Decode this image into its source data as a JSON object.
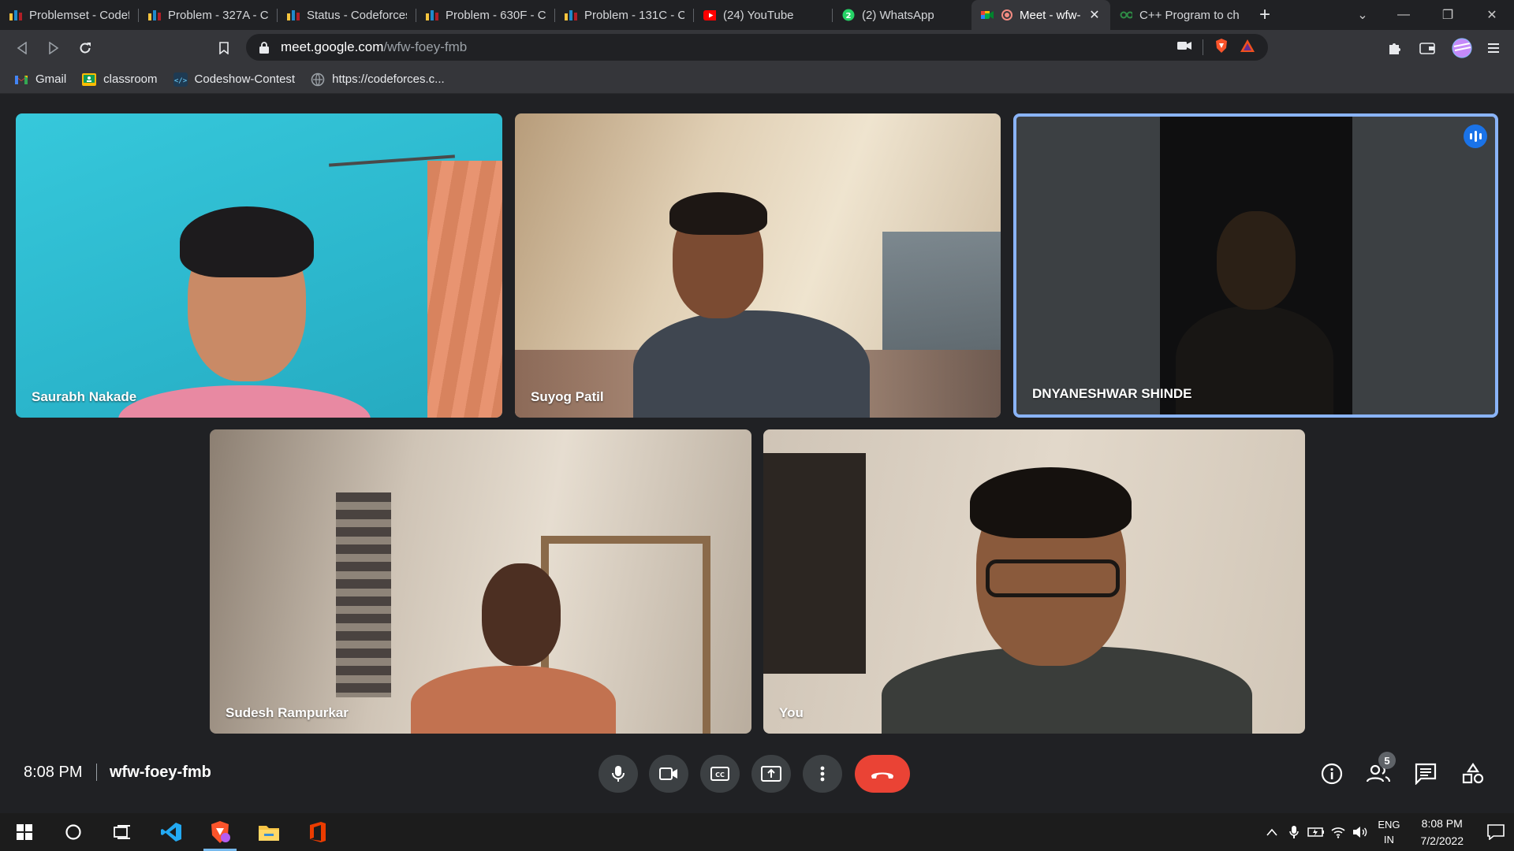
{
  "browser": {
    "tabs": [
      {
        "title": "Problemset - Codef",
        "icon": "codeforces-icon",
        "active": false
      },
      {
        "title": "Problem - 327A - Co",
        "icon": "codeforces-icon",
        "active": false
      },
      {
        "title": "Status - Codeforces",
        "icon": "codeforces-icon",
        "active": false
      },
      {
        "title": "Problem - 630F - Co",
        "icon": "codeforces-icon",
        "active": false
      },
      {
        "title": "Problem - 131C - Co",
        "icon": "codeforces-icon",
        "active": false
      },
      {
        "title": "(24) YouTube",
        "icon": "youtube-icon",
        "active": false
      },
      {
        "title": "(2) WhatsApp",
        "icon": "whatsapp-icon",
        "active": false
      },
      {
        "title": "Meet - wfw-",
        "icon": "meet-icon",
        "active": true
      },
      {
        "title": "C++ Program to ch",
        "icon": "gfg-icon",
        "active": false
      }
    ],
    "url_host": "meet.google.com",
    "url_path": "/wfw-foey-fmb",
    "bookmarks": [
      {
        "label": "Gmail",
        "icon": "gmail-icon"
      },
      {
        "label": "classroom",
        "icon": "classroom-icon"
      },
      {
        "label": "Codeshow-Contest",
        "icon": "codeshow-icon"
      },
      {
        "label": "https://codeforces.c...",
        "icon": "globe-icon"
      }
    ]
  },
  "meet": {
    "participants": [
      {
        "name": "Saurabh Nakade",
        "speaking": false
      },
      {
        "name": "Suyog Patil",
        "speaking": false
      },
      {
        "name": "DNYANESHWAR SHINDE",
        "speaking": true
      },
      {
        "name": "Sudesh Rampurkar",
        "speaking": false
      },
      {
        "name": "You",
        "speaking": false
      }
    ],
    "time": "8:08 PM",
    "meeting_code": "wfw-foey-fmb",
    "people_count": "5",
    "colors": {
      "end_call": "#ea4335",
      "speaking_border": "#8ab4f8",
      "control_bg": "#3c4043"
    }
  },
  "taskbar": {
    "language_line1": "ENG",
    "language_line2": "IN",
    "clock_time": "8:08 PM",
    "clock_date": "7/2/2022"
  }
}
